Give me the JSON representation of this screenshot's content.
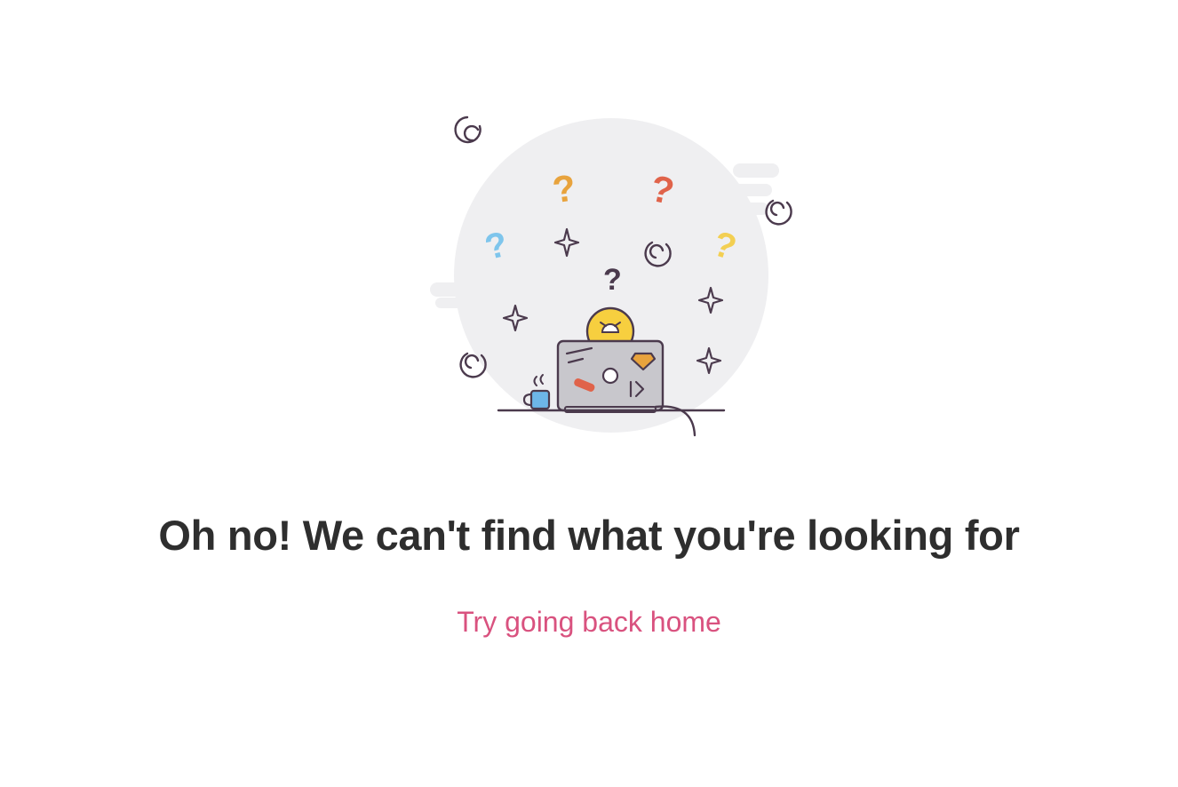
{
  "page": {
    "heading": "Oh no! We can't find what you're looking for",
    "link_label": "Try going back home"
  },
  "illustration": {
    "icon": "confused-laptop-icon",
    "glyph": "?",
    "colors": {
      "backdrop": "#efeff1",
      "outline": "#4b3a4d",
      "laptop": "#c8c7cc",
      "face": "#f7cf3f",
      "orange": "#e8a33d",
      "red": "#e0634a",
      "blue": "#7ec5ec",
      "yellow": "#f3cf52",
      "dark": "#4b3a4d",
      "cup": "#6db6e8",
      "gem": "#e8a33d",
      "sticker": "#e0634a"
    }
  },
  "theme": {
    "heading_color": "#2e2e2e",
    "link_color": "#d9527f"
  }
}
